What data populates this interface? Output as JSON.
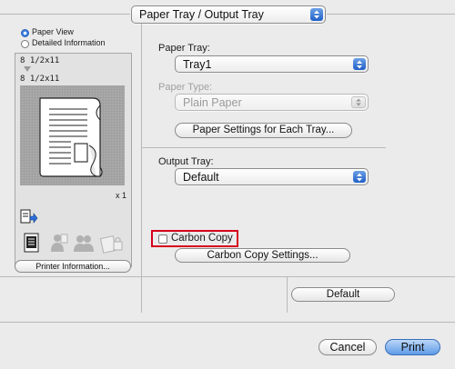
{
  "tray_selector": {
    "value": "Paper Tray / Output Tray"
  },
  "view_options": [
    {
      "label": "Paper View",
      "selected": true
    },
    {
      "label": "Detailed Information",
      "selected": false
    }
  ],
  "preview": {
    "input_size": "8 1/2x11",
    "output_size": "8 1/2x11",
    "copies": "x 1"
  },
  "printer_info_button": "Printer Information...",
  "paper_tray": {
    "label": "Paper Tray:",
    "value": "Tray1"
  },
  "paper_type": {
    "label": "Paper Type:",
    "value": "Plain Paper"
  },
  "paper_settings_button": "Paper Settings for Each Tray...",
  "output_tray": {
    "label": "Output Tray:",
    "value": "Default"
  },
  "carbon_copy": {
    "label": "Carbon Copy",
    "checked": false,
    "highlight_color": "#d6001c"
  },
  "carbon_copy_settings_button": "Carbon Copy Settings...",
  "default_button": "Default",
  "cancel_button": "Cancel",
  "print_button": "Print",
  "colors": {
    "accent": "#2f74d6",
    "window_bg": "#ebebeb"
  }
}
